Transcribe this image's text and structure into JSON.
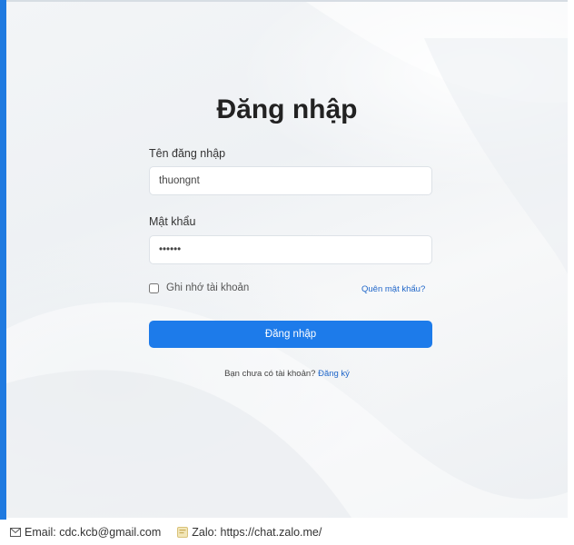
{
  "login": {
    "title": "Đăng nhập",
    "username_label": "Tên đăng nhập",
    "username_value": "thuongnt",
    "password_label": "Mật khẩu",
    "password_value": "••••••",
    "remember_label": "Ghi nhớ tài khoản",
    "forgot_label": "Quên mật khẩu?",
    "submit_label": "Đăng nhập",
    "no_account_text": "Bạn chưa có tài khoản?",
    "register_label": "Đăng ký"
  },
  "footer": {
    "email_text": "Email: cdc.kcb@gmail.com",
    "zalo_text": "Zalo: https://chat.zalo.me/"
  },
  "icons": {
    "email": "mail-icon",
    "zalo": "zalo-icon"
  },
  "colors": {
    "accent": "#1d7bea",
    "left_bar": "#1f7ae0",
    "link": "#1f66c9"
  }
}
